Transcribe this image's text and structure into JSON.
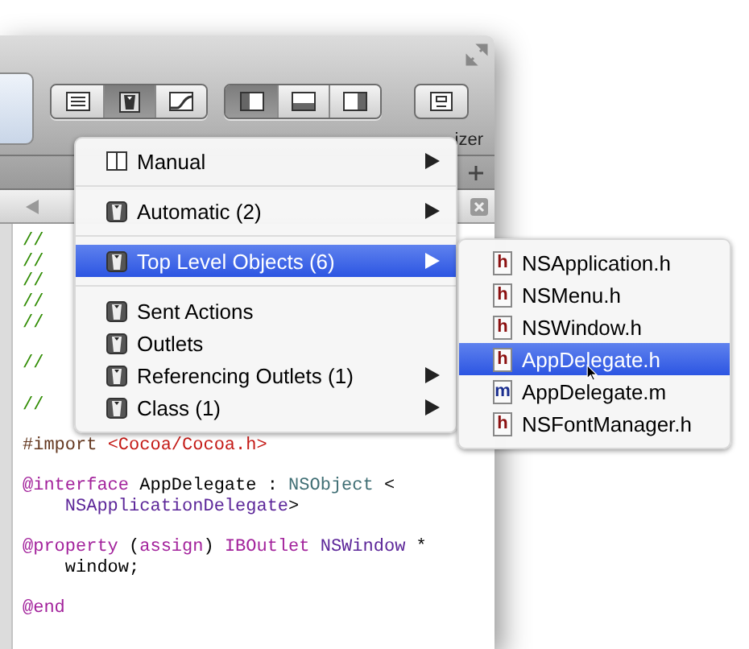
{
  "toolbar": {
    "editor_buttons": [
      {
        "kind": "standard",
        "selected": false
      },
      {
        "kind": "assistant",
        "selected": true
      },
      {
        "kind": "version",
        "selected": false
      }
    ],
    "view_buttons": [
      {
        "kind": "left",
        "selected": true
      },
      {
        "kind": "bottom",
        "selected": false
      },
      {
        "kind": "right",
        "selected": false
      }
    ],
    "organizer_label": "izer"
  },
  "code": {
    "blocks": [
      [
        [
          {
            "kind": "comment",
            "text": "//"
          }
        ],
        [
          {
            "kind": "comment",
            "text": "//"
          }
        ],
        [
          {
            "kind": "comment",
            "text": "//"
          }
        ],
        [
          {
            "kind": "comment",
            "text": "//"
          }
        ],
        [
          {
            "kind": "comment",
            "text": "//"
          }
        ]
      ],
      [
        [
          {
            "kind": "comment",
            "text": "//"
          }
        ]
      ],
      [
        [
          {
            "kind": "comment",
            "text": "//"
          }
        ]
      ],
      [
        [
          {
            "kind": "preprocessor",
            "text": "#import "
          },
          {
            "kind": "string",
            "text": "<Cocoa/Cocoa.h>"
          }
        ]
      ],
      [
        [
          {
            "kind": "keyword",
            "text": "@interface"
          },
          {
            "kind": "plain",
            "text": " AppDelegate : "
          },
          {
            "kind": "type",
            "text": "NSObject"
          },
          {
            "kind": "plain",
            "text": " <"
          }
        ],
        [
          {
            "kind": "protocol",
            "text": "    NSApplicationDelegate"
          },
          {
            "kind": "plain",
            "text": ">"
          }
        ]
      ],
      [
        [
          {
            "kind": "keyword",
            "text": "@property"
          },
          {
            "kind": "plain",
            "text": " ("
          },
          {
            "kind": "keyword",
            "text": "assign"
          },
          {
            "kind": "plain",
            "text": ") "
          },
          {
            "kind": "keyword",
            "text": "IBOutlet "
          },
          {
            "kind": "protocol",
            "text": "NSWindow"
          },
          {
            "kind": "plain",
            "text": " *"
          }
        ],
        [
          {
            "kind": "plain",
            "text": "    window;"
          }
        ]
      ],
      [
        [
          {
            "kind": "keyword",
            "text": "@end"
          }
        ]
      ]
    ]
  },
  "menu": {
    "groups": [
      [
        {
          "label": "Manual",
          "kind": "manual",
          "selected": false,
          "has_submenu": true
        }
      ],
      [
        {
          "label": "Automatic (2)",
          "kind": "object",
          "selected": false,
          "has_submenu": true
        }
      ],
      [
        {
          "label": "Top Level Objects (6)",
          "kind": "object",
          "selected": true,
          "has_submenu": true
        }
      ],
      [
        {
          "label": "Sent Actions",
          "kind": "object",
          "selected": false,
          "has_submenu": false
        },
        {
          "label": "Outlets",
          "kind": "object",
          "selected": false,
          "has_submenu": false
        },
        {
          "label": "Referencing Outlets (1)",
          "kind": "object",
          "selected": false,
          "has_submenu": true
        },
        {
          "label": "Class (1)",
          "kind": "object",
          "selected": false,
          "has_submenu": true
        }
      ]
    ]
  },
  "submenu": {
    "items": [
      {
        "label": "NSApplication.h",
        "kind": "header",
        "badge": "h",
        "selected": false
      },
      {
        "label": "NSMenu.h",
        "kind": "header",
        "badge": "h",
        "selected": false
      },
      {
        "label": "NSWindow.h",
        "kind": "header",
        "badge": "h",
        "selected": false
      },
      {
        "label": "AppDelegate.h",
        "kind": "header",
        "badge": "h",
        "selected": true
      },
      {
        "label": "AppDelegate.m",
        "kind": "implementation",
        "badge": "m",
        "selected": false
      },
      {
        "label": "NSFontManager.h",
        "kind": "header",
        "badge": "h",
        "selected": false
      }
    ]
  }
}
